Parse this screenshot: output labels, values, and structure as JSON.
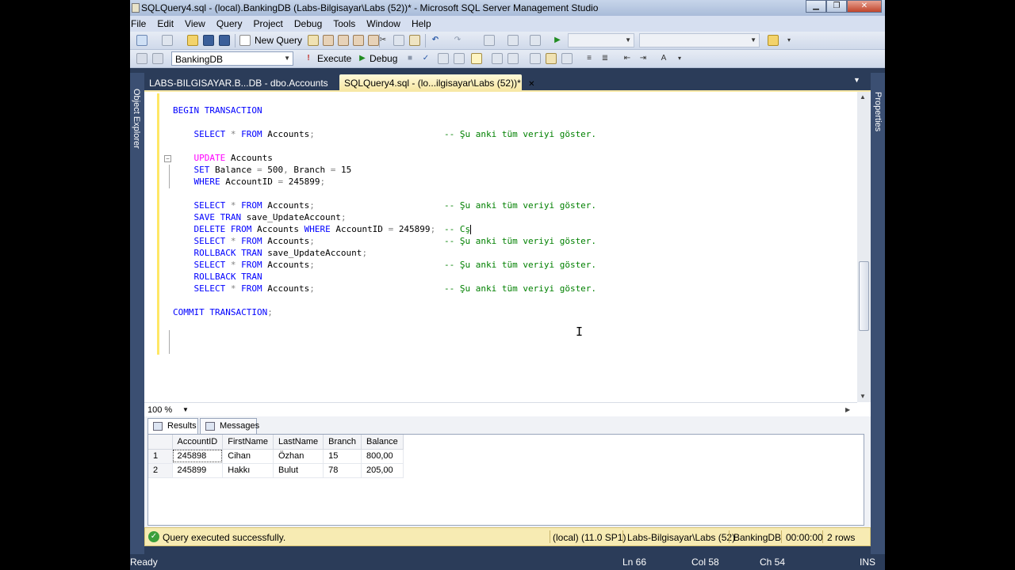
{
  "window": {
    "title": "SQLQuery4.sql - (local).BankingDB (Labs-Bilgisayar\\Labs (52))* - Microsoft SQL Server Management Studio",
    "min": "▁",
    "max": "❐",
    "close": "✕"
  },
  "menu": [
    "File",
    "Edit",
    "View",
    "Query",
    "Project",
    "Debug",
    "Tools",
    "Window",
    "Help"
  ],
  "toolbar1": {
    "new_query": "New Query"
  },
  "toolbar2": {
    "database": "BankingDB",
    "execute": "Execute",
    "debug": "Debug"
  },
  "side": {
    "left": "Object Explorer",
    "right": "Properties"
  },
  "tabs": {
    "inactive": "LABS-BILGISAYAR.B...DB - dbo.Accounts",
    "active": "SQLQuery4.sql - (lo...ilgisayar\\Labs (52))*",
    "close": "✕"
  },
  "editor": {
    "lines": [
      {
        "code": [
          {
            "t": "kw",
            "v": "BEGIN TRANSACTION"
          }
        ],
        "comment": ""
      },
      {
        "code": [],
        "comment": ""
      },
      {
        "code": [
          {
            "t": "kw",
            "v": "    SELECT "
          },
          {
            "t": "gr",
            "v": "* "
          },
          {
            "t": "kw",
            "v": "FROM "
          },
          {
            "t": "",
            "v": "Accounts"
          },
          {
            "t": "gr",
            "v": ";"
          }
        ],
        "comment": "-- Şu anki tüm veriyi göster."
      },
      {
        "code": [],
        "comment": ""
      },
      {
        "code": [
          {
            "t": "pk",
            "v": "    UPDATE "
          },
          {
            "t": "",
            "v": "Accounts"
          }
        ],
        "comment": ""
      },
      {
        "code": [
          {
            "t": "kw",
            "v": "    SET "
          },
          {
            "t": "",
            "v": "Balance "
          },
          {
            "t": "gr",
            "v": "= "
          },
          {
            "t": "",
            "v": "500"
          },
          {
            "t": "gr",
            "v": ", "
          },
          {
            "t": "",
            "v": "Branch "
          },
          {
            "t": "gr",
            "v": "= "
          },
          {
            "t": "",
            "v": "15"
          }
        ],
        "comment": ""
      },
      {
        "code": [
          {
            "t": "kw",
            "v": "    WHERE "
          },
          {
            "t": "",
            "v": "AccountID "
          },
          {
            "t": "gr",
            "v": "= "
          },
          {
            "t": "",
            "v": "245899"
          },
          {
            "t": "gr",
            "v": ";"
          }
        ],
        "comment": ""
      },
      {
        "code": [],
        "comment": ""
      },
      {
        "code": [
          {
            "t": "kw",
            "v": "    SELECT "
          },
          {
            "t": "gr",
            "v": "* "
          },
          {
            "t": "kw",
            "v": "FROM "
          },
          {
            "t": "",
            "v": "Accounts"
          },
          {
            "t": "gr",
            "v": ";"
          }
        ],
        "comment": "-- Şu anki tüm veriyi göster."
      },
      {
        "code": [
          {
            "t": "kw",
            "v": "    SAVE TRAN "
          },
          {
            "t": "",
            "v": "save_UpdateAccount"
          },
          {
            "t": "gr",
            "v": ";"
          }
        ],
        "comment": ""
      },
      {
        "code": [
          {
            "t": "kw",
            "v": "    DELETE FROM "
          },
          {
            "t": "",
            "v": "Accounts "
          },
          {
            "t": "kw",
            "v": "WHERE "
          },
          {
            "t": "",
            "v": "AccountID "
          },
          {
            "t": "gr",
            "v": "= "
          },
          {
            "t": "",
            "v": "245899"
          },
          {
            "t": "gr",
            "v": ";"
          }
        ],
        "comment": "-- Cş"
      },
      {
        "code": [
          {
            "t": "kw",
            "v": "    SELECT "
          },
          {
            "t": "gr",
            "v": "* "
          },
          {
            "t": "kw",
            "v": "FROM "
          },
          {
            "t": "",
            "v": "Accounts"
          },
          {
            "t": "gr",
            "v": ";"
          }
        ],
        "comment": "-- Şu anki tüm veriyi göster."
      },
      {
        "code": [
          {
            "t": "kw",
            "v": "    ROLLBACK TRAN "
          },
          {
            "t": "",
            "v": "save_UpdateAccount"
          },
          {
            "t": "gr",
            "v": ";"
          }
        ],
        "comment": ""
      },
      {
        "code": [
          {
            "t": "kw",
            "v": "    SELECT "
          },
          {
            "t": "gr",
            "v": "* "
          },
          {
            "t": "kw",
            "v": "FROM "
          },
          {
            "t": "",
            "v": "Accounts"
          },
          {
            "t": "gr",
            "v": ";"
          }
        ],
        "comment": "-- Şu anki tüm veriyi göster."
      },
      {
        "code": [
          {
            "t": "kw",
            "v": "    ROLLBACK TRAN"
          }
        ],
        "comment": ""
      },
      {
        "code": [
          {
            "t": "kw",
            "v": "    SELECT "
          },
          {
            "t": "gr",
            "v": "* "
          },
          {
            "t": "kw",
            "v": "FROM "
          },
          {
            "t": "",
            "v": "Accounts"
          },
          {
            "t": "gr",
            "v": ";"
          }
        ],
        "comment": "-- Şu anki tüm veriyi göster."
      },
      {
        "code": [],
        "comment": ""
      },
      {
        "code": [
          {
            "t": "kw",
            "v": "COMMIT TRANSACTION"
          },
          {
            "t": "gr",
            "v": ";"
          }
        ],
        "comment": ""
      }
    ],
    "zoom": "100 %"
  },
  "results": {
    "tab_results": "Results",
    "tab_messages": "Messages",
    "columns": [
      "AccountID",
      "FirstName",
      "LastName",
      "Branch",
      "Balance"
    ],
    "rows": [
      {
        "n": "1",
        "cells": [
          "245898",
          "Cihan",
          "Özhan",
          "15",
          "800,00"
        ]
      },
      {
        "n": "2",
        "cells": [
          "245899",
          "Hakkı",
          "Bulut",
          "78",
          "205,00"
        ]
      }
    ]
  },
  "query_status": {
    "message": "Query executed successfully.",
    "server": "(local) (11.0 SP1)",
    "user": "Labs-Bilgisayar\\Labs (52)",
    "database": "BankingDB",
    "time": "00:00:00",
    "rows": "2 rows"
  },
  "statusbar": {
    "ready": "Ready",
    "ln": "Ln 66",
    "col": "Col 58",
    "ch": "Ch 54",
    "mode": "INS"
  }
}
